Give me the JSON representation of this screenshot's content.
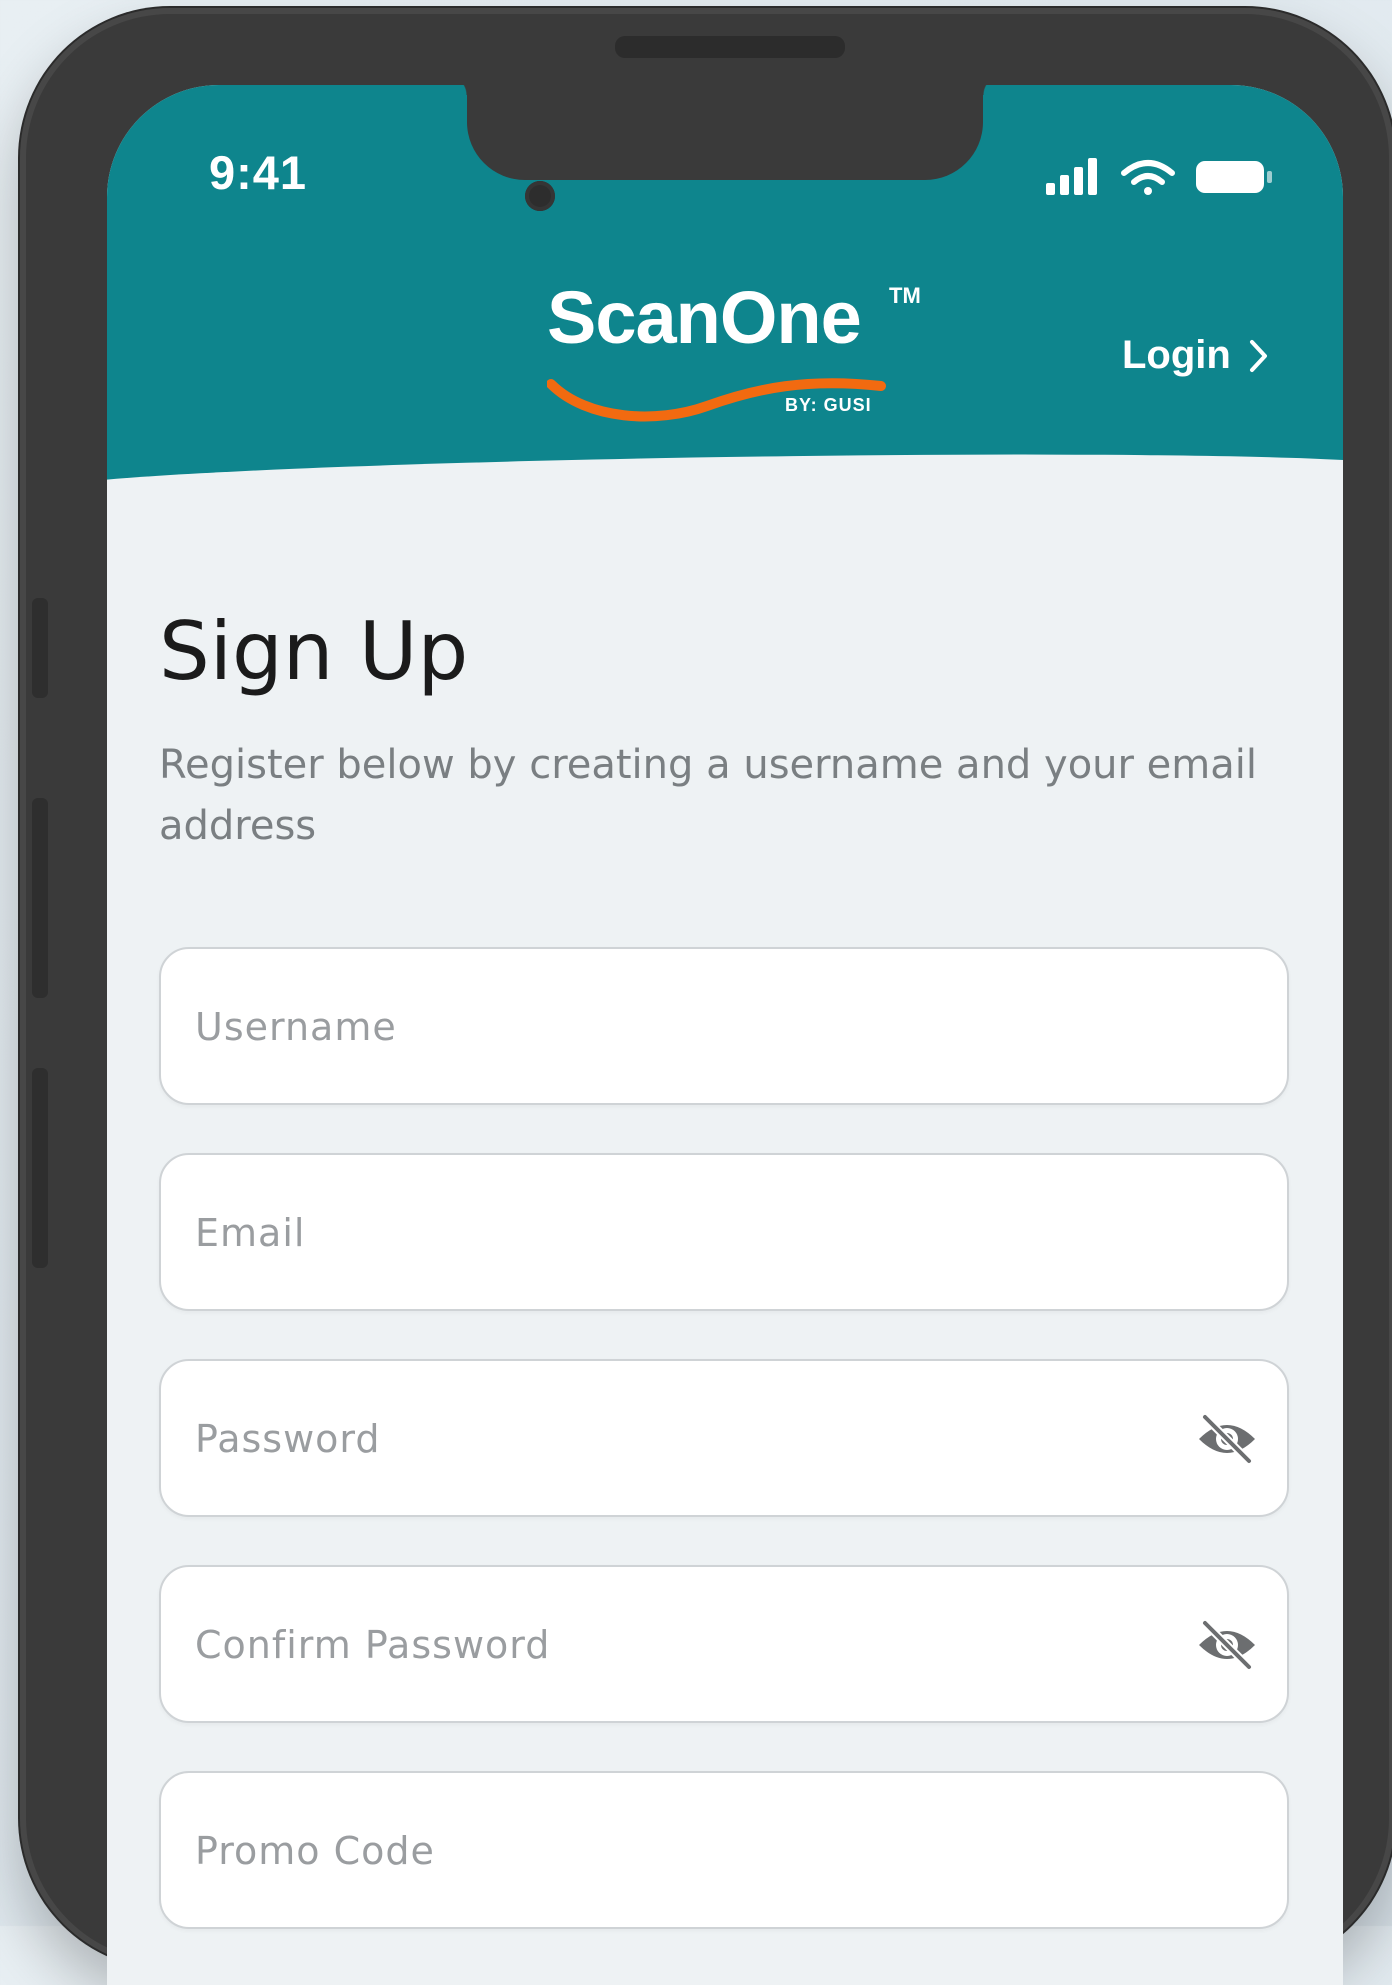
{
  "status_bar": {
    "time": "9:41"
  },
  "brand": {
    "name": "ScanOne",
    "trademark": "TM",
    "byline": "BY: GUSI"
  },
  "header": {
    "login_label": "Login"
  },
  "form": {
    "title": "Sign Up",
    "subtitle": "Register below by creating a username and your email address",
    "fields": [
      {
        "placeholder": "Username"
      },
      {
        "placeholder": "Email"
      },
      {
        "placeholder": "Password"
      },
      {
        "placeholder": "Confirm Password"
      },
      {
        "placeholder": "Promo Code"
      }
    ]
  },
  "colors": {
    "header": "#0e858d",
    "accent": "#f26a10",
    "background": "#eef2f4"
  },
  "icons": [
    "signal-icon",
    "wifi-icon",
    "battery-icon",
    "chevron-right-icon",
    "eye-off-icon"
  ]
}
